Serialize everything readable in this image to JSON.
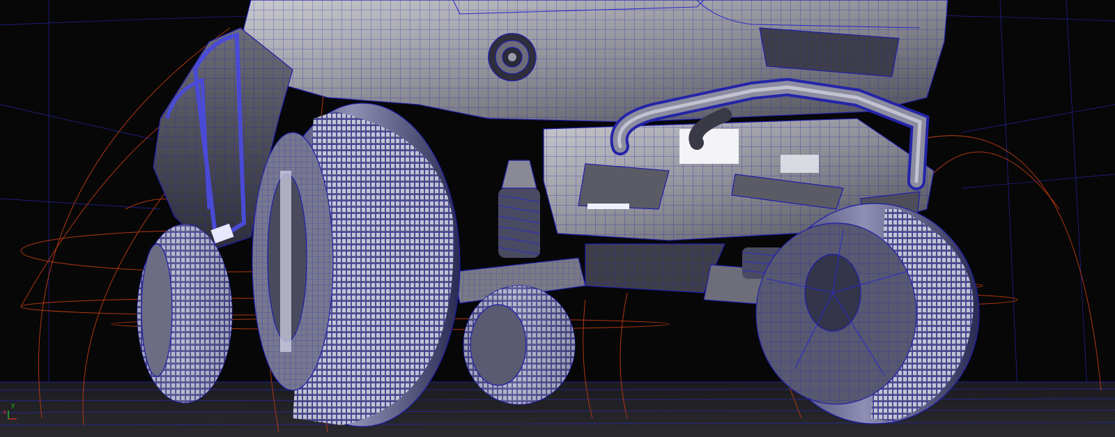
{
  "viewport": {
    "camera_label": "",
    "axis": {
      "y_label": "y",
      "x_label": "x"
    }
  },
  "colors": {
    "background": "#070707",
    "wireframe": "#2c2cc8",
    "gizmo": "#b83a12",
    "axis_y": "#1fc01f",
    "axis_x": "#d22a2a",
    "camera_label": "#1d6e1d"
  },
  "scene": {
    "subject": "vehicle-wireframe-model"
  }
}
